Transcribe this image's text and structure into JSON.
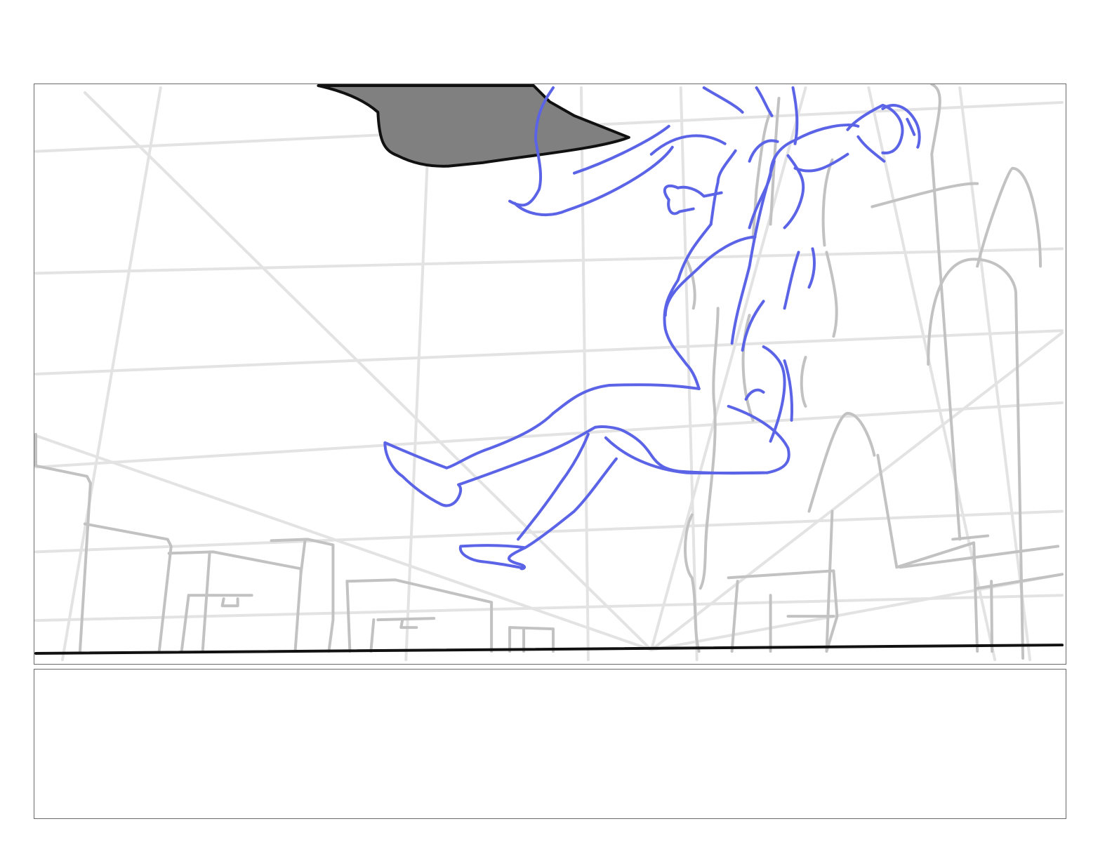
{
  "board": {
    "drawing_panel": {
      "layers": [
        "perspective-grid",
        "background-buildings",
        "shadow-shape",
        "figure-sketch",
        "ground-line"
      ],
      "colors": {
        "grid": "#e3e3e3",
        "buildings": "#c2c2c2",
        "shadow": "#808080",
        "outline": "#111111",
        "figure": "#5b63e6"
      }
    },
    "notes_panel": {
      "text": ""
    }
  }
}
